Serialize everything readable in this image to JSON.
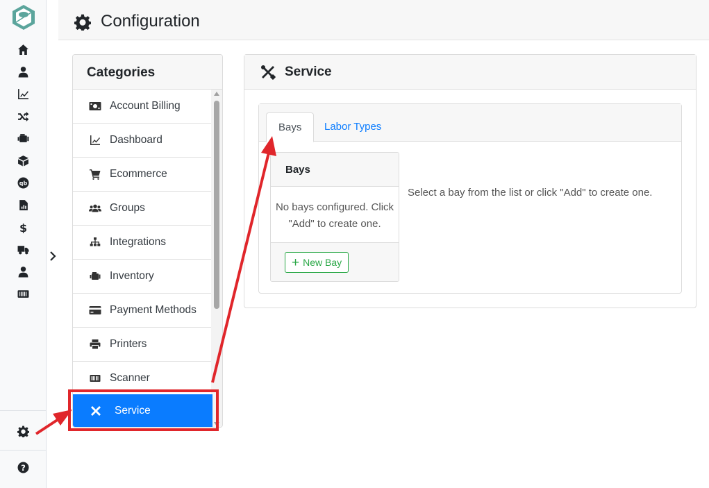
{
  "header": {
    "title": "Configuration",
    "icon": "gear-icon"
  },
  "rail": {
    "items": [
      {
        "name": "home-icon"
      },
      {
        "name": "user-icon"
      },
      {
        "name": "chart-line-icon"
      },
      {
        "name": "shuffle-icon"
      },
      {
        "name": "engine-icon"
      },
      {
        "name": "box-icon"
      },
      {
        "name": "quickbooks-icon"
      },
      {
        "name": "report-icon"
      },
      {
        "name": "dollar-icon"
      },
      {
        "name": "truck-icon"
      },
      {
        "name": "user-icon"
      },
      {
        "name": "barcode-icon"
      }
    ],
    "bottom": [
      {
        "name": "gear-icon"
      },
      {
        "name": "help-icon"
      }
    ]
  },
  "categories": {
    "title": "Categories",
    "items": [
      {
        "label": "Account Billing",
        "icon": "money-bill-icon"
      },
      {
        "label": "Dashboard",
        "icon": "chart-line-icon"
      },
      {
        "label": "Ecommerce",
        "icon": "cart-icon"
      },
      {
        "label": "Groups",
        "icon": "users-icon"
      },
      {
        "label": "Integrations",
        "icon": "sitemap-icon"
      },
      {
        "label": "Inventory",
        "icon": "engine-icon"
      },
      {
        "label": "Payment Methods",
        "icon": "credit-card-icon"
      },
      {
        "label": "Printers",
        "icon": "printer-icon"
      },
      {
        "label": "Scanner",
        "icon": "barcode-icon"
      }
    ],
    "active": {
      "label": "Service",
      "icon": "tools-icon"
    }
  },
  "service": {
    "title": "Service",
    "tabs": [
      {
        "label": "Bays",
        "active": true
      },
      {
        "label": "Labor Types",
        "active": false
      }
    ],
    "bays": {
      "title": "Bays",
      "empty": "No bays configured. Click \"Add\" to create one.",
      "new_button": "New Bay"
    },
    "hint": "Select a bay from the list or click \"Add\" to create one."
  },
  "colors": {
    "accent": "#0a7cff",
    "success": "#28a745",
    "annotation": "#e0262b"
  }
}
